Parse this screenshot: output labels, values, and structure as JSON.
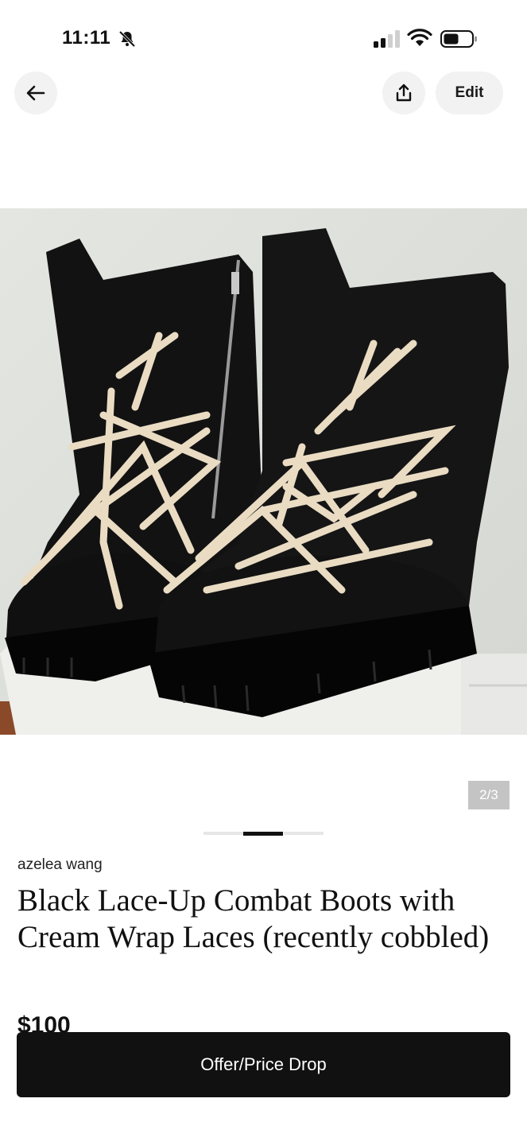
{
  "status_bar": {
    "time": "11:11",
    "icons": [
      "bell-slash-icon",
      "cellular-signal-icon",
      "wifi-icon",
      "battery-icon"
    ]
  },
  "header": {
    "back_icon": "arrow-left-icon",
    "share_icon": "share-icon",
    "edit_label": "Edit"
  },
  "gallery": {
    "counter": "2/3",
    "total_images": 3,
    "current_index": 2,
    "image_description_icon": "boots-photo"
  },
  "listing": {
    "seller": "azelea wang",
    "title": "Black Lace-Up Combat Boots with Cream Wrap Laces (recently cobbled)",
    "price": "$100"
  },
  "footer": {
    "cta_label": "Offer/Price Drop"
  },
  "colors": {
    "background": "#ffffff",
    "button_bg": "#f2f2f2",
    "cta_bg": "#111111",
    "counter_bg": "#c4c4c4"
  }
}
